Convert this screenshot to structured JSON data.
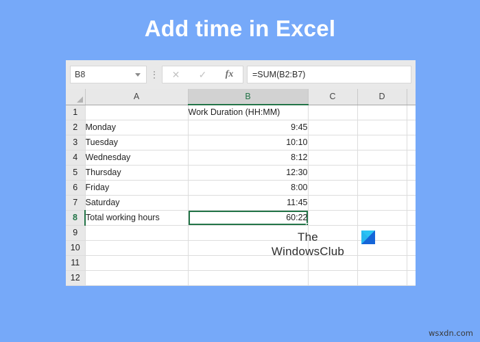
{
  "page": {
    "title": "Add time in Excel",
    "background_color": "#76a9f9",
    "title_color": "#ffffff"
  },
  "formula_bar": {
    "name_box_value": "B8",
    "name_box_dropdown_icon": "chevron-down-icon",
    "cancel_icon": "close-icon",
    "confirm_icon": "check-icon",
    "function_icon": "fx-icon",
    "formula_value": "=SUM(B2:B7)"
  },
  "sheet": {
    "selected_cell": "B8",
    "selection_color": "#217346",
    "column_headers": [
      "A",
      "B",
      "C",
      "D"
    ],
    "selected_column": "B",
    "row_headers": [
      "1",
      "2",
      "3",
      "4",
      "5",
      "6",
      "7",
      "8",
      "9",
      "10",
      "11",
      "12"
    ],
    "selected_row": "8",
    "rows": [
      {
        "num": "1",
        "a": "",
        "b": "Work Duration (HH:MM)",
        "b_align": "txt",
        "c": "",
        "d": ""
      },
      {
        "num": "2",
        "a": "Monday",
        "b": "9:45",
        "b_align": "num",
        "c": "",
        "d": ""
      },
      {
        "num": "3",
        "a": "Tuesday",
        "b": "10:10",
        "b_align": "num",
        "c": "",
        "d": ""
      },
      {
        "num": "4",
        "a": "Wednesday",
        "b": "8:12",
        "b_align": "num",
        "c": "",
        "d": ""
      },
      {
        "num": "5",
        "a": "Thursday",
        "b": "12:30",
        "b_align": "num",
        "c": "",
        "d": ""
      },
      {
        "num": "6",
        "a": "Friday",
        "b": "8:00",
        "b_align": "num",
        "c": "",
        "d": ""
      },
      {
        "num": "7",
        "a": "Saturday",
        "b": "11:45",
        "b_align": "num",
        "c": "",
        "d": ""
      },
      {
        "num": "8",
        "a": "Total working hours",
        "b": "60:22",
        "b_align": "num",
        "c": "",
        "d": ""
      },
      {
        "num": "9",
        "a": "",
        "b": "",
        "b_align": "txt",
        "c": "",
        "d": ""
      },
      {
        "num": "10",
        "a": "",
        "b": "",
        "b_align": "txt",
        "c": "",
        "d": ""
      },
      {
        "num": "11",
        "a": "",
        "b": "",
        "b_align": "txt",
        "c": "",
        "d": ""
      },
      {
        "num": "12",
        "a": "",
        "b": "",
        "b_align": "txt",
        "c": "",
        "d": ""
      }
    ]
  },
  "watermark": {
    "line1": "The",
    "line2": "WindowsClub",
    "logo_icon": "windowsclub-logo-icon"
  },
  "source_watermark": {
    "text": "wsxdn.com"
  }
}
